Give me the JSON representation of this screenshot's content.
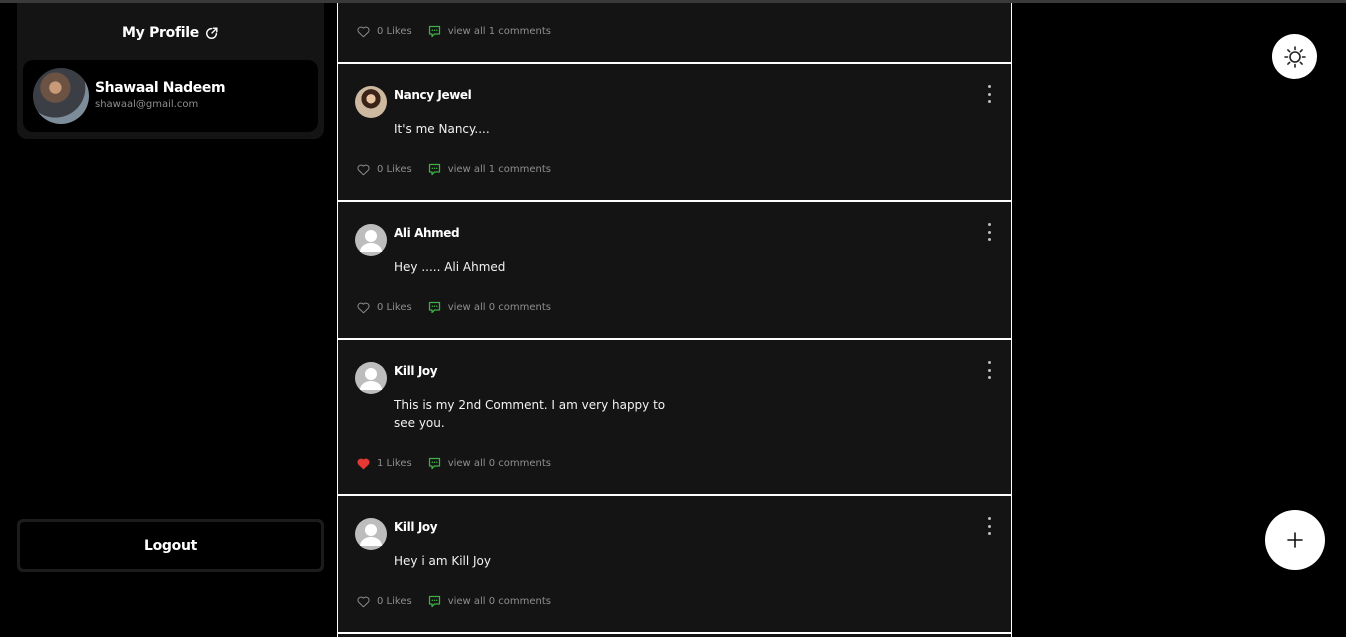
{
  "sidebar": {
    "profile_title": "My Profile",
    "user": {
      "name": "Shawaal Nadeem",
      "email": "shawaal@gmail.com"
    },
    "logout_label": "Logout"
  },
  "feed": {
    "posts": [
      {
        "author": "",
        "content": "",
        "likes": "0 Likes",
        "liked": false,
        "comments": "view all 1 comments"
      },
      {
        "author": "Nancy Jewel",
        "content": "It's me Nancy....",
        "likes": "0 Likes",
        "liked": false,
        "comments": "view all 1 comments"
      },
      {
        "author": "Ali Ahmed",
        "content": "Hey ..... Ali Ahmed",
        "likes": "0 Likes",
        "liked": false,
        "comments": "view all 0 comments"
      },
      {
        "author": "Kill Joy",
        "content": "This is my 2nd Comment. I am very happy to see you.",
        "likes": "1 Likes",
        "liked": true,
        "comments": "view all 0 comments"
      },
      {
        "author": "Kill Joy",
        "content": "Hey i am Kill Joy",
        "likes": "0 Likes",
        "liked": false,
        "comments": "view all 0 comments"
      }
    ]
  },
  "colors": {
    "background": "#000000",
    "card": "#141414",
    "comment_icon": "#3cb043",
    "liked_heart": "#e53935",
    "muted_text": "#8e8e8e"
  },
  "icons": {
    "profile_link": "external-link-icon",
    "theme_toggle": "sun-icon",
    "add_post": "plus-icon",
    "like": "heart-icon",
    "comment": "comment-icon",
    "post_menu": "more-vertical-icon"
  }
}
